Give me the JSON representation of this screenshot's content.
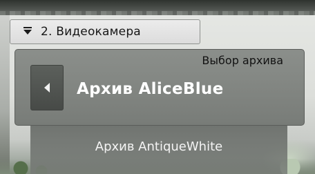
{
  "camera_selector": {
    "value": "2. Видеокамера"
  },
  "archive_panel": {
    "title": "Выбор архива",
    "current_archive": "Архив AliceBlue",
    "next_archive": "Архив AntiqueWhite"
  },
  "icons": {
    "dropdown": "chevron-down-icon",
    "previous": "triangle-left-icon"
  }
}
